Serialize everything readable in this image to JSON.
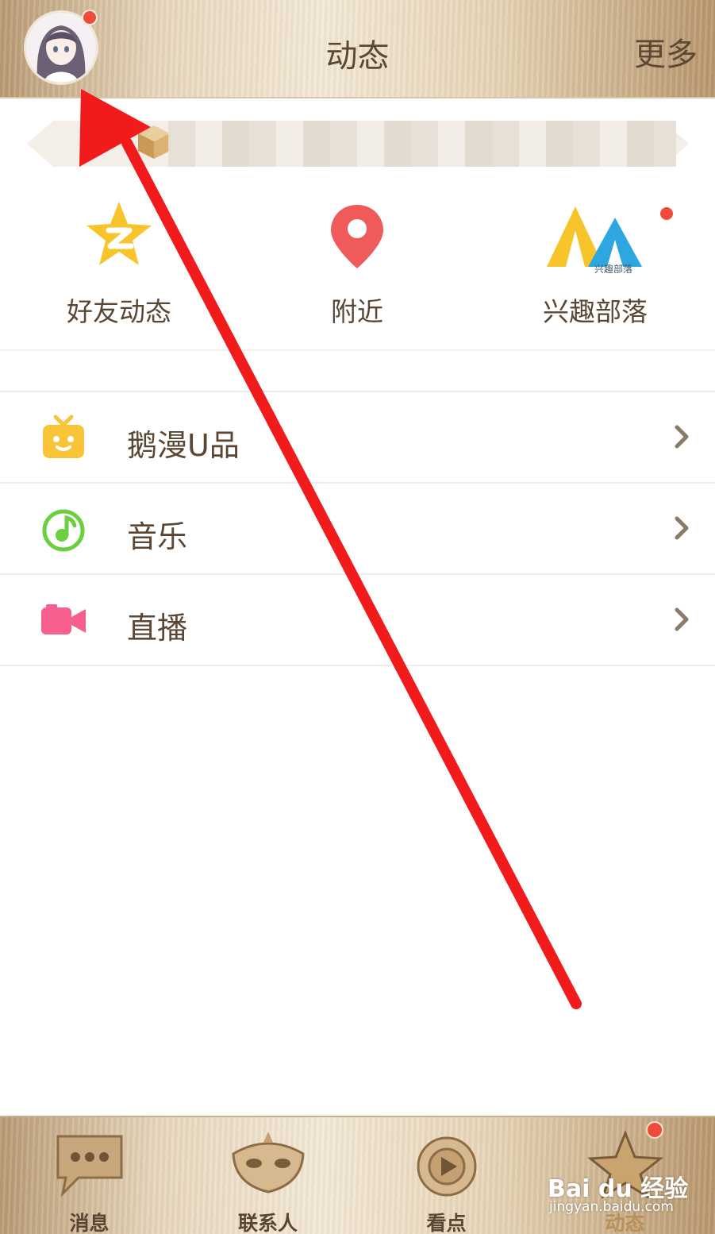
{
  "header": {
    "title": "动态",
    "more_label": "更多",
    "avatar_icon": "user-avatar-icon"
  },
  "banner": {
    "icon": "gift-box-icon"
  },
  "quick_entries": [
    {
      "label": "好友动态",
      "icon": "qzone-star-icon",
      "color": "#f7c52b"
    },
    {
      "label": "附近",
      "icon": "location-pin-icon",
      "color": "#ef5b5b"
    },
    {
      "label": "兴趣部落",
      "icon": "tent-icon",
      "color": "#f7c52b",
      "icon_text": "兴趣部落"
    }
  ],
  "list": [
    {
      "label": "鹅漫U品",
      "icon": "gift-face-icon",
      "color": "#f9c43a"
    },
    {
      "label": "音乐",
      "icon": "music-note-icon",
      "color": "#6ccf3f"
    },
    {
      "label": "直播",
      "icon": "video-camera-icon",
      "color": "#f7608c"
    }
  ],
  "tabs": [
    {
      "label": "消息",
      "icon": "chat-bubble-icon"
    },
    {
      "label": "联系人",
      "icon": "mask-icon"
    },
    {
      "label": "看点",
      "icon": "play-circle-icon"
    },
    {
      "label": "动态",
      "icon": "star-icon",
      "active": true
    }
  ],
  "watermark": {
    "logo": "Bai du 经验",
    "url": "jingyan.baidu.com"
  },
  "colors": {
    "text_brown": "#5a4632",
    "badge_red": "#f04a3a",
    "annotation_red": "#f21b1b"
  }
}
